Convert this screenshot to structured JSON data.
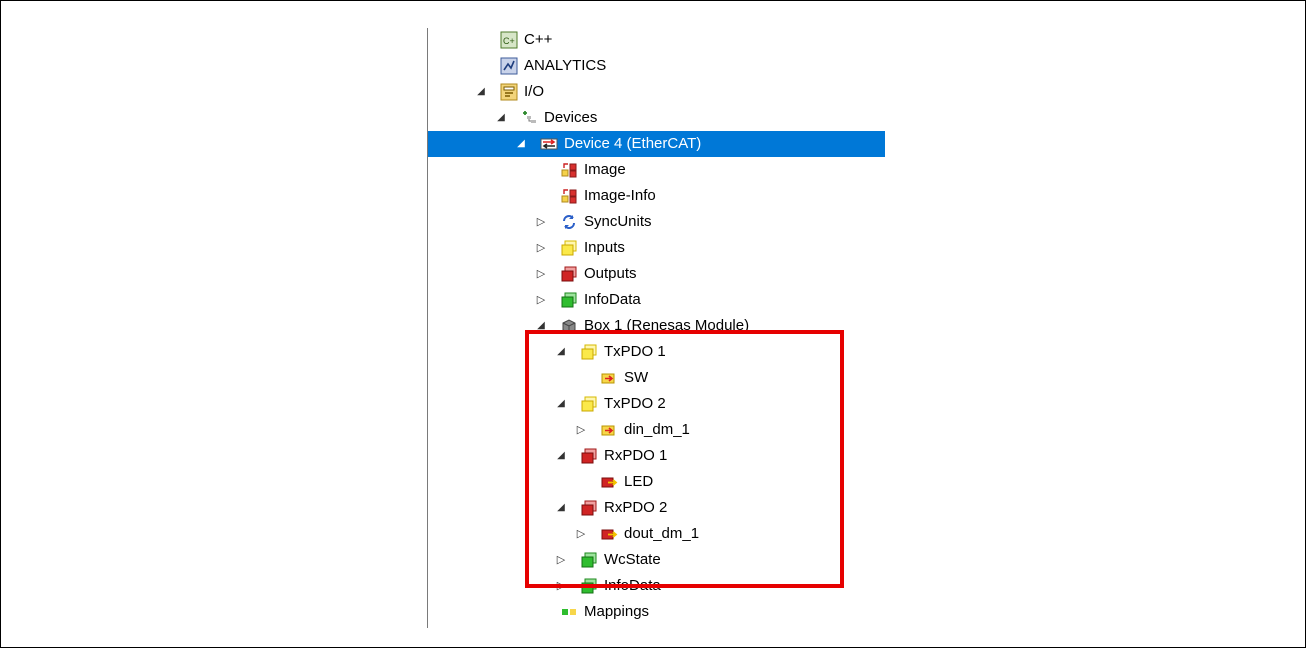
{
  "tree": {
    "rows": [
      {
        "label": "C++",
        "icon": "cpp-icon",
        "indent": 0,
        "expander": "none"
      },
      {
        "label": "ANALYTICS",
        "icon": "analytics-icon",
        "indent": 0,
        "expander": "none"
      },
      {
        "label": "I/O",
        "icon": "io-icon",
        "indent": 0,
        "expander": "expanded"
      },
      {
        "label": "Devices",
        "icon": "devices-icon",
        "indent": 1,
        "expander": "expanded"
      },
      {
        "label": "Device 4 (EtherCAT)",
        "icon": "ethercat-device-icon",
        "indent": 2,
        "expander": "expanded",
        "selected": true
      },
      {
        "label": "Image",
        "icon": "image-icon",
        "indent": 3,
        "expander": "none"
      },
      {
        "label": "Image-Info",
        "icon": "image-icon",
        "indent": 3,
        "expander": "none"
      },
      {
        "label": "SyncUnits",
        "icon": "sync-icon",
        "indent": 3,
        "expander": "collapsed"
      },
      {
        "label": "Inputs",
        "icon": "inputs-icon",
        "indent": 3,
        "expander": "collapsed"
      },
      {
        "label": "Outputs",
        "icon": "outputs-icon",
        "indent": 3,
        "expander": "collapsed"
      },
      {
        "label": "InfoData",
        "icon": "infodata-icon",
        "indent": 3,
        "expander": "collapsed"
      },
      {
        "label": "Box 1 (Renesas Module)",
        "icon": "box-icon",
        "indent": 3,
        "expander": "expanded"
      },
      {
        "label": "TxPDO 1",
        "icon": "inputs-icon",
        "indent": 4,
        "expander": "expanded"
      },
      {
        "label": "SW",
        "icon": "input-var-icon",
        "indent": 5,
        "expander": "none"
      },
      {
        "label": "TxPDO 2",
        "icon": "inputs-icon",
        "indent": 4,
        "expander": "expanded"
      },
      {
        "label": "din_dm_1",
        "icon": "input-var-icon",
        "indent": 5,
        "expander": "collapsed"
      },
      {
        "label": "RxPDO 1",
        "icon": "outputs-icon",
        "indent": 4,
        "expander": "expanded"
      },
      {
        "label": "LED",
        "icon": "output-var-icon",
        "indent": 5,
        "expander": "none"
      },
      {
        "label": "RxPDO 2",
        "icon": "outputs-icon",
        "indent": 4,
        "expander": "expanded"
      },
      {
        "label": "dout_dm_1",
        "icon": "output-var-icon",
        "indent": 5,
        "expander": "collapsed"
      },
      {
        "label": "WcState",
        "icon": "infodata-icon",
        "indent": 4,
        "expander": "collapsed"
      },
      {
        "label": "InfoData",
        "icon": "infodata-icon",
        "indent": 4,
        "expander": "collapsed"
      }
    ],
    "partial_row": {
      "label": "Mappings",
      "icon": "mappings-icon"
    }
  },
  "highlight_color": "#e60000",
  "selection_color": "#0078d7"
}
